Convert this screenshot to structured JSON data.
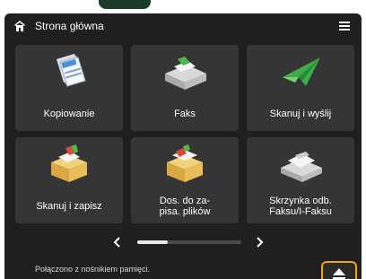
{
  "header": {
    "title": "Strona główna",
    "home_icon": "home-icon",
    "menu_icon": "menu-icon"
  },
  "tiles": [
    {
      "label": "Kopiowanie",
      "icon": "copy-icon"
    },
    {
      "label": "Faks",
      "icon": "fax-icon"
    },
    {
      "label": "Skanuj i wyślij",
      "icon": "scan-send-icon"
    },
    {
      "label": "Skanuj i zapisz",
      "icon": "scan-store-icon"
    },
    {
      "label": "Dos. do za-\npisa. plików",
      "icon": "access-stored-files-icon"
    },
    {
      "label": "Skrzynka odb.\nFaksu/I-Faksu",
      "icon": "fax-inbox-icon"
    }
  ],
  "pager": {
    "prev_icon": "chevron-left-icon",
    "next_icon": "chevron-right-icon",
    "current_page": 1,
    "total_pages": 3
  },
  "status": {
    "text": "Połączono z nośnikiem pamięci.",
    "eject_icon": "eject-icon"
  },
  "colors": {
    "panel": "#1f1f1f",
    "tile": "#353535",
    "accent": "#f2a21b"
  }
}
